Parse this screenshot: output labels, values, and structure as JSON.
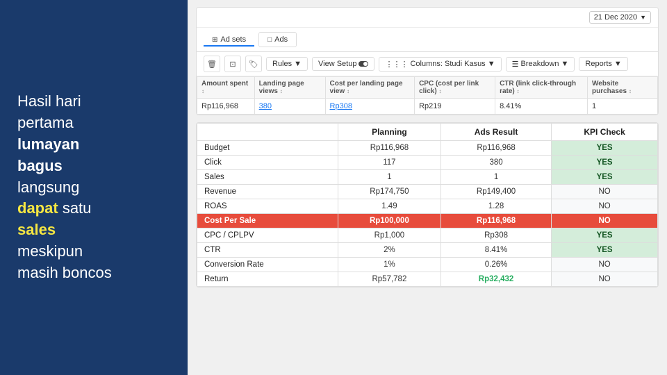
{
  "left": {
    "line1": "Hasil hari",
    "line2": "pertama",
    "line3": "lumayan",
    "line4": "bagus",
    "line5": "langsung",
    "line6_pre": "",
    "line6_yellow": "dapat",
    "line6_post": " satu",
    "line7_yellow": "sales",
    "line8": "meskipun",
    "line9": "masih boncos"
  },
  "ads_manager": {
    "date": "21 Dec 2020",
    "tabs": [
      {
        "label": "Ad sets",
        "active": true
      },
      {
        "label": "Ads",
        "active": false
      }
    ],
    "toolbar": {
      "rules_label": "Rules",
      "view_setup_label": "View Setup",
      "columns_label": "Columns: Studi Kasus",
      "breakdown_label": "Breakdown",
      "reports_label": "Reports"
    },
    "columns": [
      "Amount spent",
      "Landing page views",
      "Cost per landing page view",
      "CPC (cost per link click)",
      "CTR (link click-through rate)",
      "Website purchases"
    ],
    "row": {
      "amount_spent": "Rp116,968",
      "landing_page_views": "380",
      "cost_per_lpv": "Rp308",
      "cpc": "Rp219",
      "ctr": "8.41%",
      "website_purchases": "1"
    }
  },
  "summary": {
    "headers": [
      "",
      "Planning",
      "Ads Result",
      "KPI Check"
    ],
    "rows": [
      {
        "label": "Budget",
        "planning": "Rp116,968",
        "ads_result": "Rp116,968",
        "kpi": "YES",
        "kpi_color": "green",
        "highlight": false
      },
      {
        "label": "Click",
        "planning": "117",
        "ads_result": "380",
        "kpi": "YES",
        "kpi_color": "green",
        "highlight": false
      },
      {
        "label": "Sales",
        "planning": "1",
        "ads_result": "1",
        "kpi": "YES",
        "kpi_color": "green",
        "highlight": false
      },
      {
        "label": "Revenue",
        "planning": "Rp174,750",
        "ads_result": "Rp149,400",
        "kpi": "NO",
        "kpi_color": "gray",
        "highlight": false
      },
      {
        "label": "ROAS",
        "planning": "1.49",
        "ads_result": "1.28",
        "kpi": "NO",
        "kpi_color": "gray",
        "highlight": false
      },
      {
        "label": "Cost Per Sale",
        "planning": "Rp100,000",
        "ads_result": "Rp116,968",
        "kpi": "NO",
        "kpi_color": "red",
        "highlight": true
      },
      {
        "label": "CPC / CPLPV",
        "planning": "Rp1,000",
        "ads_result": "Rp308",
        "kpi": "YES",
        "kpi_color": "green",
        "highlight": false
      },
      {
        "label": "CTR",
        "planning": "2%",
        "ads_result": "8.41%",
        "kpi": "YES",
        "kpi_color": "green",
        "highlight": false
      },
      {
        "label": "Conversion Rate",
        "planning": "1%",
        "ads_result": "0.26%",
        "kpi": "NO",
        "kpi_color": "gray",
        "highlight": false
      },
      {
        "label": "Return",
        "planning": "Rp57,782",
        "ads_result": "Rp32,432",
        "kpi": "NO",
        "kpi_color": "gray",
        "highlight": false,
        "ads_result_green": true
      }
    ]
  }
}
